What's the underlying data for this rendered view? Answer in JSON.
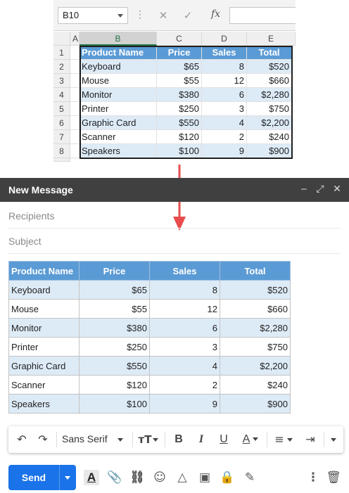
{
  "excel": {
    "name_box": "B10",
    "cancel_icon": "close-icon",
    "enter_icon": "check-icon",
    "fx_label": "fx",
    "column_headers": [
      "A",
      "B",
      "C",
      "D",
      "E"
    ],
    "row_numbers": [
      "1",
      "2",
      "3",
      "4",
      "5",
      "6",
      "7",
      "8"
    ],
    "table_header": [
      "Product Name",
      "Price",
      "Sales",
      "Total"
    ],
    "rows": [
      [
        "Keyboard",
        "$65",
        "8",
        "$520"
      ],
      [
        "Mouse",
        "$55",
        "12",
        "$660"
      ],
      [
        "Monitor",
        "$380",
        "6",
        "$2,280"
      ],
      [
        "Printer",
        "$250",
        "3",
        "$750"
      ],
      [
        "Graphic Card",
        "$550",
        "4",
        "$2,200"
      ],
      [
        "Scanner",
        "$120",
        "2",
        "$240"
      ],
      [
        "Speakers",
        "$100",
        "9",
        "$900"
      ]
    ],
    "header_color": "#5b9bd5",
    "band_color": "#ddebf7"
  },
  "arrow_color": "#e84c4c",
  "compose": {
    "title": "New Message",
    "recipients_placeholder": "Recipients",
    "subject_placeholder": "Subject",
    "table_header": [
      "Product Name",
      "Price",
      "Sales",
      "Total"
    ],
    "rows": [
      [
        "Keyboard",
        "$65",
        "8",
        "$520"
      ],
      [
        "Mouse",
        "$55",
        "12",
        "$660"
      ],
      [
        "Monitor",
        "$380",
        "6",
        "$2,280"
      ],
      [
        "Printer",
        "$250",
        "3",
        "$750"
      ],
      [
        "Graphic Card",
        "$550",
        "4",
        "$2,200"
      ],
      [
        "Scanner",
        "$120",
        "2",
        "$240"
      ],
      [
        "Speakers",
        "$100",
        "9",
        "$900"
      ]
    ],
    "font_name": "Sans Serif",
    "send_label": "Send",
    "send_color": "#1a73e8"
  }
}
